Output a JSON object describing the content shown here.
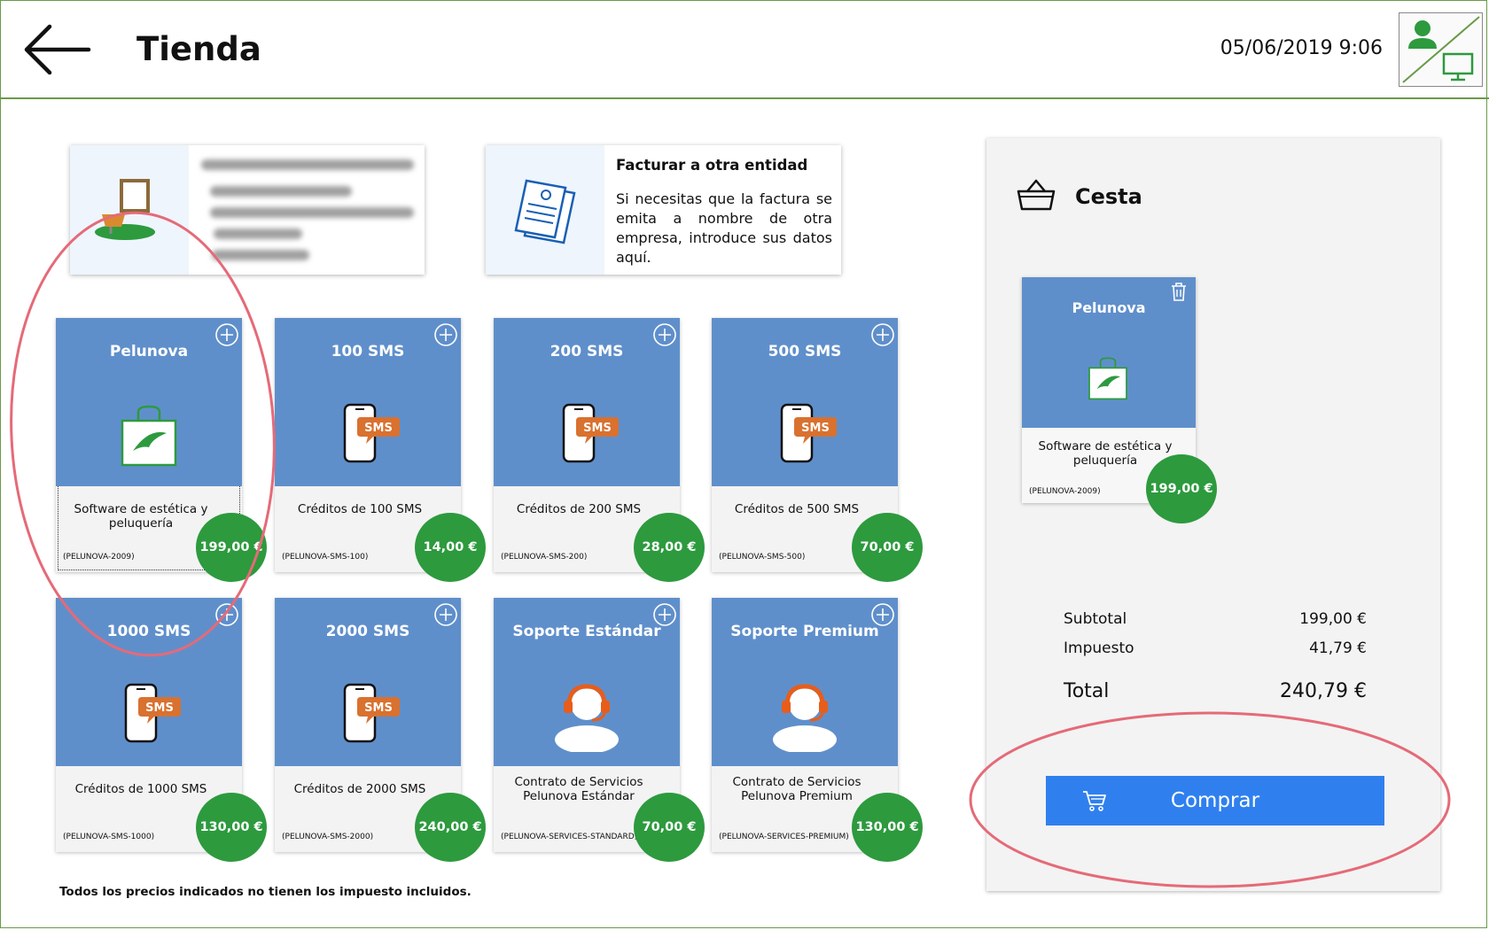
{
  "header": {
    "title": "Tienda",
    "datetime": "05/06/2019 9:06"
  },
  "bill_card": {
    "title": "Facturar a otra entidad",
    "text": "Si necesitas que la factura se emita a nombre de otra empresa, introduce sus datos aquí."
  },
  "products": [
    {
      "name": "Pelunova",
      "description": "Software de estética y peluquería",
      "code": "(PELUNOVA-2009)",
      "price": "199,00 €",
      "icon": "shopping-bag-leaf-icon"
    },
    {
      "name": "100 SMS",
      "description": "Créditos de 100 SMS",
      "code": "(PELUNOVA-SMS-100)",
      "price": "14,00 €",
      "icon": "sms-phone-icon"
    },
    {
      "name": "200 SMS",
      "description": "Créditos de 200 SMS",
      "code": "(PELUNOVA-SMS-200)",
      "price": "28,00 €",
      "icon": "sms-phone-icon"
    },
    {
      "name": "500 SMS",
      "description": "Créditos de 500 SMS",
      "code": "(PELUNOVA-SMS-500)",
      "price": "70,00 €",
      "icon": "sms-phone-icon"
    },
    {
      "name": "1000 SMS",
      "description": "Créditos de 1000 SMS",
      "code": "(PELUNOVA-SMS-1000)",
      "price": "130,00 €",
      "icon": "sms-phone-icon"
    },
    {
      "name": "2000 SMS",
      "description": "Créditos de 2000 SMS",
      "code": "(PELUNOVA-SMS-2000)",
      "price": "240,00 €",
      "icon": "sms-phone-icon"
    },
    {
      "name": "Soporte Estándar",
      "description": "Contrato de Servicios Pelunova Estándar",
      "code": "(PELUNOVA-SERVICES-STANDARD)",
      "price": "70,00 €",
      "icon": "support-headset-icon"
    },
    {
      "name": "Soporte Premium",
      "description": "Contrato de Servicios Pelunova Premium",
      "code": "(PELUNOVA-SERVICES-PREMIUM)",
      "price": "130,00 €",
      "icon": "support-headset-icon"
    }
  ],
  "sms_badge": "SMS",
  "footnote": "Todos los precios indicados no tienen los impuesto incluidos.",
  "basket": {
    "title": "Cesta",
    "item": {
      "name": "Pelunova",
      "description": "Software de estética y peluquería",
      "code": "(PELUNOVA-2009)",
      "price": "199,00 €"
    },
    "subtotal_label": "Subtotal",
    "subtotal": "199,00 €",
    "tax_label": "Impuesto",
    "tax": "41,79 €",
    "total_label": "Total",
    "total": "240,79 €",
    "buy_label": "Comprar"
  },
  "colors": {
    "accent_green": "#2d9a3e",
    "card_blue": "#5f8fcb",
    "buy_blue": "#2f80ee",
    "annotation_red": "#e56a78"
  }
}
